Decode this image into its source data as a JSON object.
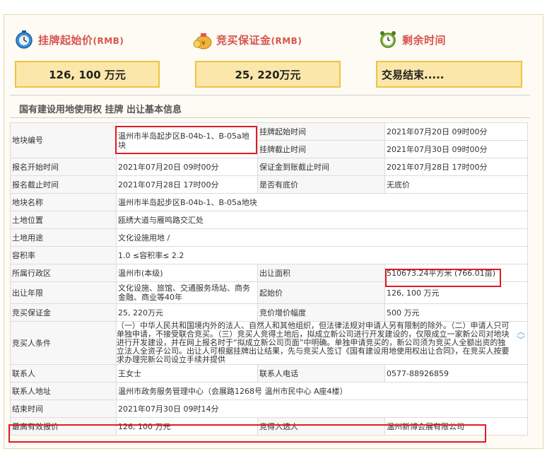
{
  "header": {
    "start_price": {
      "label": "挂牌起始价",
      "unit": "(RMB)",
      "value": "126, 100 万元"
    },
    "deposit": {
      "label": "竞买保证金",
      "unit": "(RMB)",
      "value": "25, 220万元"
    },
    "remaining": {
      "label": "剩余时间",
      "value": "交易结束....."
    }
  },
  "section_title": "国有建设用地使用权 挂牌 出让基本信息",
  "table": {
    "r1": {
      "l1": "地块编号",
      "v1": "温州市半岛起步区B-04b-1、B-05a地块",
      "l2a": "挂牌起始时间",
      "v2a": "2021年07月20日 09时00分",
      "l2b": "挂牌截止时间",
      "v2b": "2021年07月30日 09时00分"
    },
    "r2": {
      "l1": "报名开始时间",
      "v1": "2021年07月20日 09时00分",
      "l2": "保证金到账截止时间",
      "v2": "2021年07月28日 17时00分"
    },
    "r3": {
      "l1": "报名截止时间",
      "v1": "2021年07月28日 17时00分",
      "l2": "是否有底价",
      "v2": "无底价"
    },
    "r4": {
      "l1": "地块名称",
      "v1": "温州市半岛起步区B-04b-1、B-05a地块"
    },
    "r5": {
      "l1": "土地位置",
      "v1": "瓯绣大道与雁鸣路交汇处"
    },
    "r6": {
      "l1": "土地用途",
      "v1": "文化设施用地 /"
    },
    "r7": {
      "l1": "容积率",
      "v1": "1.0 ≤容积率≤ 2.2"
    },
    "r8": {
      "l1": "所属行政区",
      "v1": "温州市(本级)",
      "l2": "出让面积",
      "v2": "510673.24平方米 (766.01亩)"
    },
    "r9": {
      "l1": "出让年限",
      "v1": "文化设施、旅馆、交通服务场站、商务金融、商业等40年",
      "l2": "起始价",
      "v2": "126, 100 万元"
    },
    "r10": {
      "l1": "竞买保证金",
      "v1": "25, 220万元",
      "l2": "竞价增价幅度",
      "v2": "500 万元"
    },
    "r11": {
      "l1": "竞买人条件",
      "v1": "（一）中华人民共和国境内外的法人、自然人和其他组织，但法律法规对申请人另有限制的除外。（二）申请人只可单独申请，不接受联合竞买。（三）竞买人竞得土地后，拟成立新公司进行开发建设的，仅限成立一家新公司对地块进行开发建设，并在网上报名时于“拟成立新公司页面”中明确。单独申请竞买的，新公司须为竞买人全额出资的独立法人全资子公司。出让人可根据挂牌出让结果，先与竞买人签订《国有建设用地使用权出让合同》，在竞买人按要求办理完新公司设立手续并提供"
    },
    "r12": {
      "l1": "联系人",
      "v1": "王女士",
      "l2": "联系人电话",
      "v2": "0577-88926859"
    },
    "r13": {
      "l1": "联系人地址",
      "v1": "温州市政务服务管理中心（会展路1268号 温州市民中心 A座4楼）"
    },
    "r14": {
      "l1": "结束时间",
      "v1": "2021年07月30日 09时14分"
    },
    "r15": {
      "l1": "最高有效报价",
      "v1": "126, 100 万元",
      "l2": "竞得入选人",
      "v2": "温州新博会展有限公司"
    }
  }
}
